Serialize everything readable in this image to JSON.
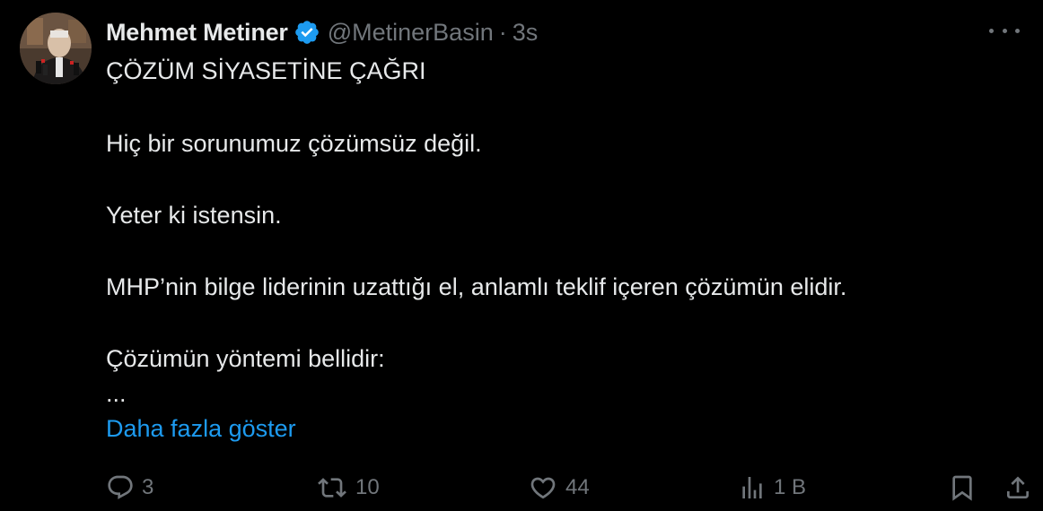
{
  "tweet": {
    "author": {
      "display_name": "Mehmet Metiner",
      "handle": "@MetinerBasin",
      "separator": "·",
      "time": "3s",
      "verified_icon": "verified-badge-icon"
    },
    "text_lines": [
      "ÇÖZÜM SİYASETİNE ÇAĞRI",
      "Hiç bir sorunumuz çözümsüz değil.",
      "Yeter ki istensin.",
      "MHP’nin bilge liderinin uzattığı el, anlamlı teklif içeren çözümün elidir.",
      "Çözümün yöntemi bellidir:",
      "..."
    ],
    "show_more_label": "Daha fazla göster",
    "actions": {
      "reply_count": "3",
      "retweet_count": "10",
      "like_count": "44",
      "views_count": "1 B"
    },
    "icons": {
      "reply": "reply-icon",
      "retweet": "retweet-icon",
      "like": "heart-icon",
      "views": "views-icon",
      "bookmark": "bookmark-icon",
      "share": "share-icon",
      "more": "more-icon"
    },
    "colors": {
      "background": "#000000",
      "text": "#e7e9ea",
      "muted": "#71767b",
      "link": "#1d9bf0",
      "verified": "#1d9bf0"
    }
  }
}
